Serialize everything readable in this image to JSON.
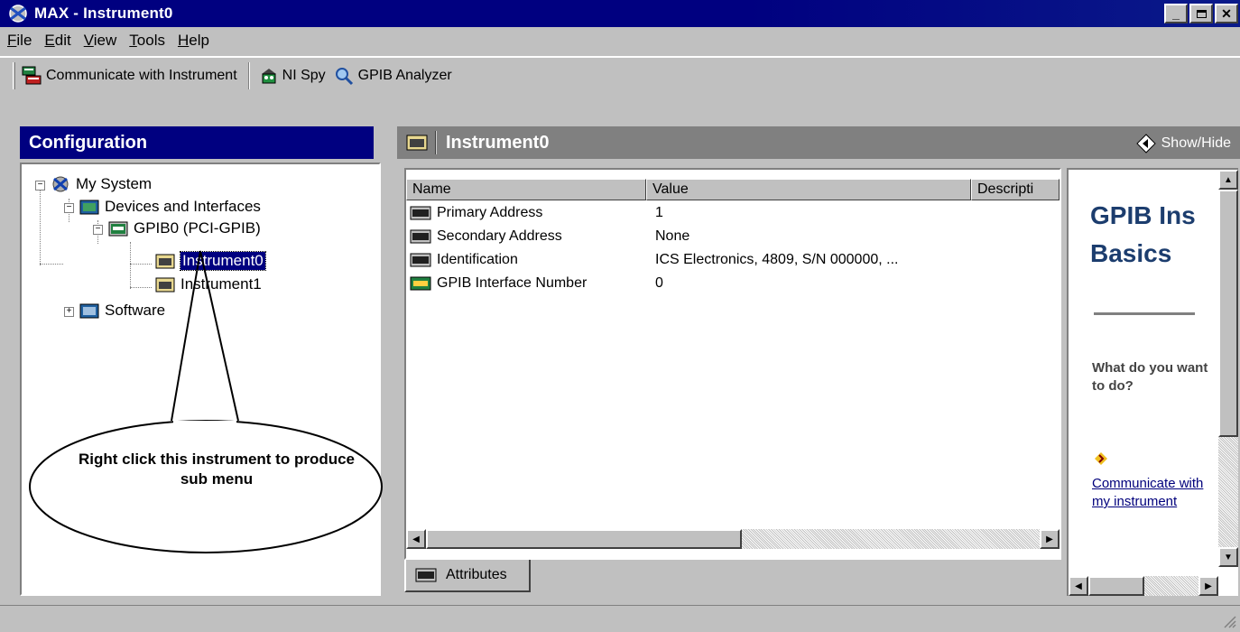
{
  "window": {
    "title": "MAX - Instrument0"
  },
  "menu": [
    {
      "acc": "F",
      "rest": "ile"
    },
    {
      "acc": "E",
      "rest": "dit"
    },
    {
      "acc": "V",
      "rest": "iew"
    },
    {
      "acc": "T",
      "rest": "ools"
    },
    {
      "acc": "H",
      "rest": "elp"
    }
  ],
  "toolbar": {
    "communicate": "Communicate with Instrument",
    "nispy": "NI Spy",
    "analyzer": "GPIB Analyzer"
  },
  "config": {
    "title": "Configuration",
    "tree": {
      "root": "My System",
      "devices": "Devices and Interfaces",
      "gpib": "GPIB0 (PCI-GPIB)",
      "instrument0": "Instrument0",
      "instrument1": "Instrument1",
      "software": "Software"
    }
  },
  "main": {
    "title": "Instrument0",
    "show_hide": "Show/Hide",
    "columns": [
      "Name",
      "Value",
      "Descripti"
    ],
    "rows": [
      {
        "name": "Primary Address",
        "value": "1"
      },
      {
        "name": "Secondary Address",
        "value": "None"
      },
      {
        "name": "Identification",
        "value": "ICS Electronics, 4809, S/N 000000, ..."
      },
      {
        "name": "GPIB Interface Number",
        "value": "0"
      }
    ],
    "tab": "Attributes"
  },
  "help": {
    "title_line1": "GPIB Ins",
    "title_line2": "Basics",
    "question": "What do you want to do?",
    "link": "Communicate with my instrument"
  },
  "annotation": {
    "text": "Right click this instrument to produce sub menu"
  },
  "colors": {
    "titlebar": "#000080",
    "selection": "#000080",
    "face": "#c0c0c0",
    "help_title": "#1c3d6e"
  }
}
